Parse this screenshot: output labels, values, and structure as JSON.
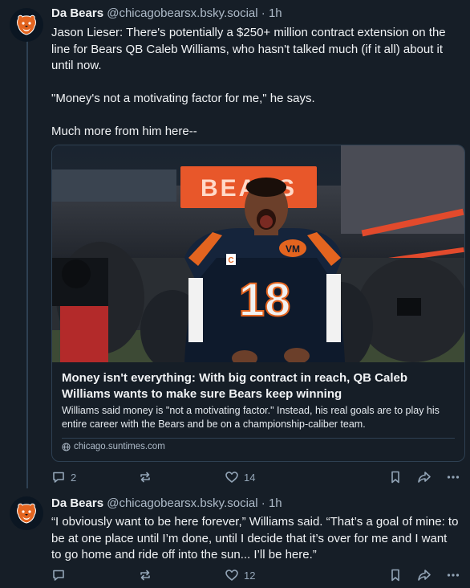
{
  "posts": [
    {
      "author": "Da Bears",
      "handle": "@chicagobearsx.bsky.social",
      "separator": "·",
      "time": "1h",
      "text": "Jason Lieser: There's potentially a $250+ million contract extension on the line for Bears QB Caleb Williams, who hasn't talked much (if it all) about it until now.\n\n\"Money's not a motivating factor for me,\" he says.\n\nMuch more from him here--",
      "card": {
        "image_sign": "BEARS",
        "jersey_number": "18",
        "title": "Money isn't everything: With big contract in reach, QB Caleb Williams wants to make sure Bears keep winning",
        "description": "Williams said money is \"not a motivating factor.\" Instead, his real goals are to play his entire career with the Bears and be on a championship-caliber team.",
        "domain": "chicago.suntimes.com"
      },
      "replies": "2",
      "likes": "14"
    },
    {
      "author": "Da Bears",
      "handle": "@chicagobearsx.bsky.social",
      "separator": "·",
      "time": "1h",
      "text": "“I obviously want to be here forever,” Williams said. “That’s a goal of mine: to be at one place until I’m done, until I decide that it’s over for me and I want to go home and ride off into the sun... I’ll be here.”",
      "replies": "",
      "likes": "12"
    }
  ],
  "colors": {
    "background": "#161e27",
    "border": "#2e4052",
    "muted_text": "#aebbc9",
    "icon": "#93a5b7",
    "bears_orange": "#e3641f",
    "bears_navy": "#0b1622"
  },
  "icons": [
    "bears-logo-icon",
    "reply-icon",
    "repost-icon",
    "like-icon",
    "bookmark-icon",
    "share-icon",
    "more-icon",
    "globe-icon"
  ]
}
